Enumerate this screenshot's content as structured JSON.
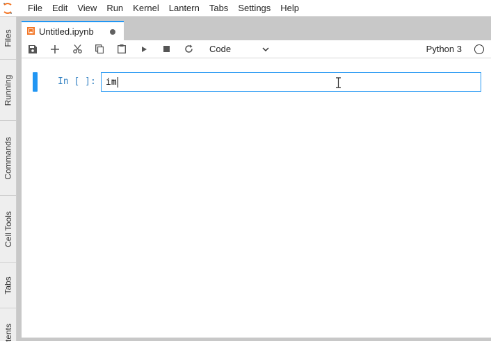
{
  "menubar": {
    "items": [
      "File",
      "Edit",
      "View",
      "Run",
      "Kernel",
      "Lantern",
      "Tabs",
      "Settings",
      "Help"
    ]
  },
  "sidebar": {
    "tabs": [
      "Files",
      "Running",
      "Commands",
      "Cell Tools",
      "Tabs",
      "tents"
    ]
  },
  "document_tab": {
    "title": "Untitled.ipynb",
    "unsaved": true
  },
  "toolbar": {
    "buttons": [
      "save-icon",
      "add-icon",
      "cut-icon",
      "copy-icon",
      "paste-icon",
      "run-icon",
      "stop-icon",
      "restart-icon"
    ],
    "cell_type": "Code",
    "kernel_name": "Python 3"
  },
  "cell": {
    "prompt": "In [ ]:",
    "source": "im"
  },
  "colors": {
    "accent": "#2196f3",
    "prompt": "#307fc1",
    "logo": "#f37626"
  }
}
